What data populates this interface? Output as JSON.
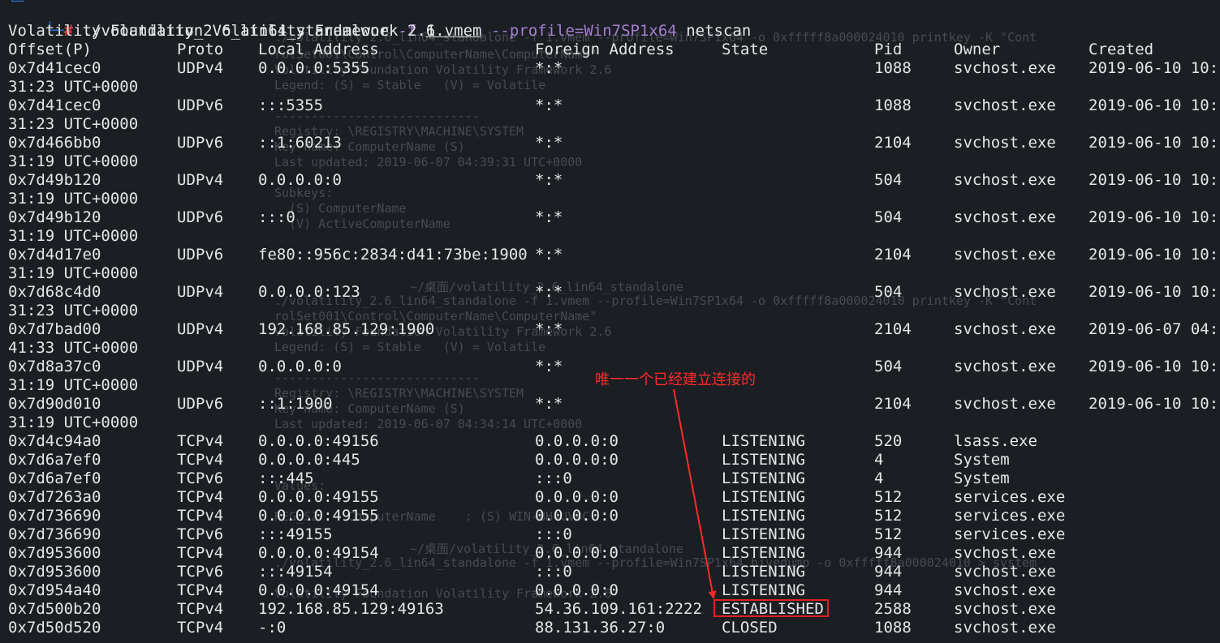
{
  "prompt": {
    "top_stub": "└─",
    "tree": "└─",
    "hash": "#",
    "command": "./volatility_2.6_lin64_standalone",
    "flag_f": "-f",
    "file": "1.vmem",
    "profile": "--profile=Win7SP1x64",
    "plugin": "netscan"
  },
  "banner": "Volatility Foundation Volatility Framework 2.6",
  "headers": {
    "offset": "Offset(P)",
    "proto": "Proto",
    "local": "Local Address",
    "foreign": "Foreign Address",
    "state": "State",
    "pid": "Pid",
    "owner": "Owner",
    "created": "Created"
  },
  "udp_rows": [
    {
      "offset": "0x7d41cec0",
      "proto": "UDPv4",
      "local": "0.0.0.0:5355",
      "foreign": "*:*",
      "state": "",
      "pid": "1088",
      "owner": "svchost.exe",
      "created": "2019-06-10 10:",
      "wrap": "31:23 UTC+0000"
    },
    {
      "offset": "0x7d41cec0",
      "proto": "UDPv6",
      "local": ":::5355",
      "foreign": "*:*",
      "state": "",
      "pid": "1088",
      "owner": "svchost.exe",
      "created": "2019-06-10 10:",
      "wrap": "31:23 UTC+0000"
    },
    {
      "offset": "0x7d466bb0",
      "proto": "UDPv6",
      "local": "::1:60213",
      "foreign": "*:*",
      "state": "",
      "pid": "2104",
      "owner": "svchost.exe",
      "created": "2019-06-10 10:",
      "wrap": "31:19 UTC+0000"
    },
    {
      "offset": "0x7d49b120",
      "proto": "UDPv4",
      "local": "0.0.0.0:0",
      "foreign": "*:*",
      "state": "",
      "pid": "504",
      "owner": "svchost.exe",
      "created": "2019-06-10 10:",
      "wrap": "31:19 UTC+0000"
    },
    {
      "offset": "0x7d49b120",
      "proto": "UDPv6",
      "local": ":::0",
      "foreign": "*:*",
      "state": "",
      "pid": "504",
      "owner": "svchost.exe",
      "created": "2019-06-10 10:",
      "wrap": "31:19 UTC+0000"
    },
    {
      "offset": "0x7d4d17e0",
      "proto": "UDPv6",
      "local": "fe80::956c:2834:d41:73be:1900",
      "foreign": "*:*",
      "state": "",
      "pid": "2104",
      "owner": "svchost.exe",
      "created": "2019-06-10 10:",
      "wrap": "31:19 UTC+0000"
    },
    {
      "offset": "0x7d68c4d0",
      "proto": "UDPv4",
      "local": "0.0.0.0:123",
      "foreign": "*:*",
      "state": "",
      "pid": "504",
      "owner": "svchost.exe",
      "created": "2019-06-10 10:",
      "wrap": "31:23 UTC+0000"
    },
    {
      "offset": "0x7d7bad00",
      "proto": "UDPv4",
      "local": "192.168.85.129:1900",
      "foreign": "*:*",
      "state": "",
      "pid": "2104",
      "owner": "svchost.exe",
      "created": "2019-06-07 04:",
      "wrap": "41:33 UTC+0000"
    },
    {
      "offset": "0x7d8a37c0",
      "proto": "UDPv4",
      "local": "0.0.0.0:0",
      "foreign": "*:*",
      "state": "",
      "pid": "504",
      "owner": "svchost.exe",
      "created": "2019-06-10 10:",
      "wrap": "31:19 UTC+0000"
    },
    {
      "offset": "0x7d90d010",
      "proto": "UDPv6",
      "local": "::1:1900",
      "foreign": "*:*",
      "state": "",
      "pid": "2104",
      "owner": "svchost.exe",
      "created": "2019-06-10 10:",
      "wrap": "31:19 UTC+0000"
    }
  ],
  "tcp_rows": [
    {
      "offset": "0x7d4c94a0",
      "proto": "TCPv4",
      "local": "0.0.0.0:49156",
      "foreign": "0.0.0.0:0",
      "state": "LISTENING",
      "pid": "520",
      "owner": "lsass.exe"
    },
    {
      "offset": "0x7d6a7ef0",
      "proto": "TCPv4",
      "local": "0.0.0.0:445",
      "foreign": "0.0.0.0:0",
      "state": "LISTENING",
      "pid": "4",
      "owner": "System"
    },
    {
      "offset": "0x7d6a7ef0",
      "proto": "TCPv6",
      "local": ":::445",
      "foreign": ":::0",
      "state": "LISTENING",
      "pid": "4",
      "owner": "System"
    },
    {
      "offset": "0x7d7263a0",
      "proto": "TCPv4",
      "local": "0.0.0.0:49155",
      "foreign": "0.0.0.0:0",
      "state": "LISTENING",
      "pid": "512",
      "owner": "services.exe"
    },
    {
      "offset": "0x7d736690",
      "proto": "TCPv4",
      "local": "0.0.0.0:49155",
      "foreign": "0.0.0.0:0",
      "state": "LISTENING",
      "pid": "512",
      "owner": "services.exe"
    },
    {
      "offset": "0x7d736690",
      "proto": "TCPv6",
      "local": ":::49155",
      "foreign": ":::0",
      "state": "LISTENING",
      "pid": "512",
      "owner": "services.exe"
    },
    {
      "offset": "0x7d953600",
      "proto": "TCPv4",
      "local": "0.0.0.0:49154",
      "foreign": "0.0.0.0:0",
      "state": "LISTENING",
      "pid": "944",
      "owner": "svchost.exe"
    },
    {
      "offset": "0x7d953600",
      "proto": "TCPv6",
      "local": ":::49154",
      "foreign": ":::0",
      "state": "LISTENING",
      "pid": "944",
      "owner": "svchost.exe"
    },
    {
      "offset": "0x7d954a40",
      "proto": "TCPv4",
      "local": "0.0.0.0:49154",
      "foreign": "0.0.0.0:0",
      "state": "LISTENING",
      "pid": "944",
      "owner": "svchost.exe"
    },
    {
      "offset": "0x7d500b20",
      "proto": "TCPv4",
      "local": "192.168.85.129:49163",
      "foreign": "54.36.109.161:2222",
      "state": "ESTABLISHED",
      "pid": "2588",
      "owner": "svchost.exe"
    },
    {
      "offset": "0x7d50d520",
      "proto": "TCPv4",
      "local": "-:0",
      "foreign": "88.131.36.27:0",
      "state": "CLOSED",
      "pid": "1088",
      "owner": "svchost.exe"
    }
  ],
  "annotation": "唯一一个已经建立连接的",
  "ghost_lines": [
    "./volatility_2.6_lin64_standalone -f 1.vmem --profile=Win7SP1x64 -o 0xfffff8a000024010 printkey -K \"Cont",
    "rolSet001\\Control\\ComputerName\\ComputerName\"",
    "Volatility Foundation Volatility Framework 2.6",
    "Legend: (S) = Stable   (V) = Volatile",
    "----------------------------",
    "Registry: \\REGISTRY\\MACHINE\\SYSTEM",
    "Key name: ComputerName (S)",
    "Last updated: 2019-06-07 04:39:31 UTC+0000",
    "Subkeys:",
    "  (S) ComputerName",
    "  (V) ActiveComputerName",
    "~/桌面/volatility_2.6_lin64_standalone",
    "./volatility_2.6_lin64_standalone -f 1.vmem --profile=Win7SP1x64 -o 0xfffff8a000024010 printkey -K \"Cont",
    "rolSet001\\Control\\ComputerName\\ComputerName\"",
    "Volatility Foundation Volatility Framework 2.6",
    "Legend: (S) = Stable   (V) = Volatile",
    "----------------------------",
    "Registry: \\REGISTRY\\MACHINE\\SYSTEM",
    "Key name: ComputerName (S)",
    "Last updated: 2019-06-07 04:34:14 UTC+0000",
    "Values:",
    "REG_SZ    ComputerName    : (S) WIN-BH4UV8C",
    "~/桌面/volatility_2.6_lin64_standalone",
    "./volatility_2.6_lin64_standalone -f 1.vmem --profile=Win7SP1x64 hivedump -o 0xfffff8a000024010 > system",
    "Volatility Foundation Volatility Framework 2.6"
  ],
  "colors": {
    "background": "#1b1e23",
    "text": "#e6e6e6",
    "prompt_blue": "#2f6fc4",
    "prompt_red": "#d73a3a",
    "flag_purple": "#a37fd0",
    "annotation_red": "#ff2a2a"
  }
}
